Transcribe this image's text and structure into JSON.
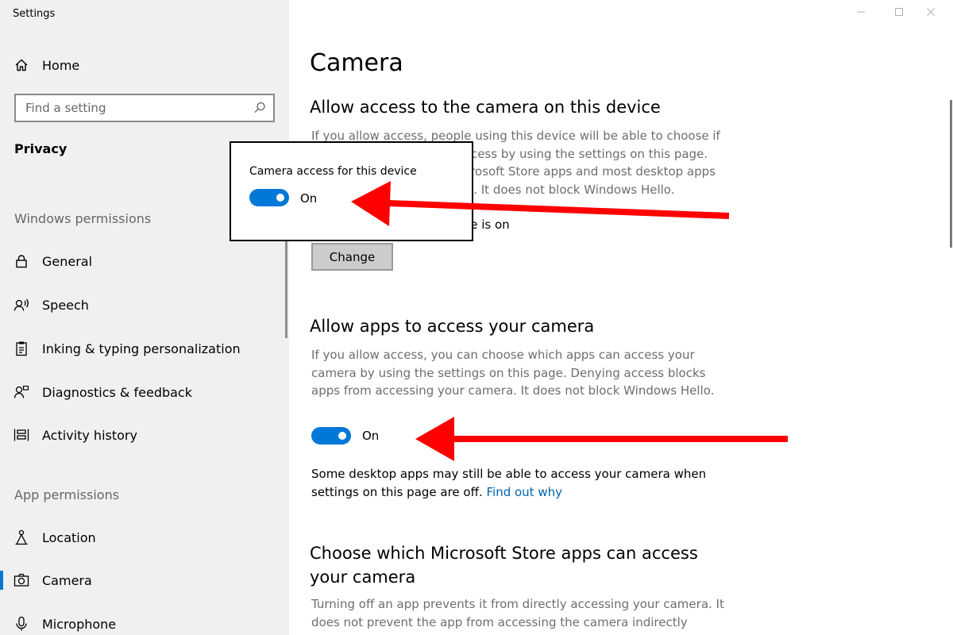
{
  "window": {
    "title": "Settings",
    "controls": {
      "minimize": "minimize-icon",
      "maximize": "maximize-icon",
      "close": "close-icon"
    }
  },
  "sidebar": {
    "home_label": "Home",
    "search": {
      "placeholder": "Find a setting"
    },
    "section_title": "Privacy",
    "windows_permissions_label": "Windows permissions",
    "windows_items": [
      {
        "label": "General",
        "icon": "lock-icon"
      },
      {
        "label": "Speech",
        "icon": "speech-icon"
      },
      {
        "label": "Inking & typing personalization",
        "icon": "clipboard-icon"
      },
      {
        "label": "Diagnostics & feedback",
        "icon": "person-feedback-icon"
      },
      {
        "label": "Activity history",
        "icon": "activity-history-icon"
      }
    ],
    "app_permissions_label": "App permissions",
    "app_items": [
      {
        "label": "Location",
        "icon": "location-icon"
      },
      {
        "label": "Camera",
        "icon": "camera-icon",
        "selected": true
      },
      {
        "label": "Microphone",
        "icon": "microphone-icon"
      }
    ]
  },
  "main": {
    "title": "Camera",
    "device_access": {
      "heading": "Allow access to the camera on this device",
      "description": "If you allow access, people using this device will be able to choose if their apps have camera access by using the settings on this page. Denying access blocks Microsoft Store apps and most desktop apps from accessing the camera. It does not block Windows Hello.",
      "status_visible": "ce is on",
      "change_label": "Change"
    },
    "apps_access": {
      "heading": "Allow apps to access your camera",
      "description": "If you allow access, you can choose which apps can access your camera by using the settings on this page. Denying access blocks apps from accessing your camera. It does not block Windows Hello.",
      "toggle_state": "On",
      "note_text": "Some desktop apps may still be able to access your camera when settings on this page are off.",
      "note_link": "Find out why"
    },
    "store_apps": {
      "heading": "Choose which Microsoft Store apps can access your camera",
      "description": "Turning off an app prevents it from directly accessing your camera. It does not prevent the app from accessing the camera indirectly"
    }
  },
  "popup": {
    "title": "Camera access for this device",
    "toggle_state": "On"
  },
  "colors": {
    "accent": "#0078d7",
    "link": "#0063b1",
    "arrow": "#ff0000",
    "sidebar_bg": "#f0f0f0"
  }
}
